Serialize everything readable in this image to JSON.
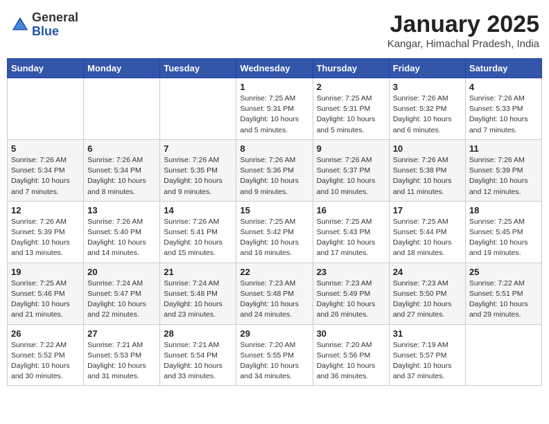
{
  "header": {
    "logo_general": "General",
    "logo_blue": "Blue",
    "title": "January 2025",
    "subtitle": "Kangar, Himachal Pradesh, India"
  },
  "weekdays": [
    "Sunday",
    "Monday",
    "Tuesday",
    "Wednesday",
    "Thursday",
    "Friday",
    "Saturday"
  ],
  "weeks": [
    [
      {
        "day": "",
        "info": ""
      },
      {
        "day": "",
        "info": ""
      },
      {
        "day": "",
        "info": ""
      },
      {
        "day": "1",
        "info": "Sunrise: 7:25 AM\nSunset: 5:31 PM\nDaylight: 10 hours\nand 5 minutes."
      },
      {
        "day": "2",
        "info": "Sunrise: 7:25 AM\nSunset: 5:31 PM\nDaylight: 10 hours\nand 5 minutes."
      },
      {
        "day": "3",
        "info": "Sunrise: 7:26 AM\nSunset: 5:32 PM\nDaylight: 10 hours\nand 6 minutes."
      },
      {
        "day": "4",
        "info": "Sunrise: 7:26 AM\nSunset: 5:33 PM\nDaylight: 10 hours\nand 7 minutes."
      }
    ],
    [
      {
        "day": "5",
        "info": "Sunrise: 7:26 AM\nSunset: 5:34 PM\nDaylight: 10 hours\nand 7 minutes."
      },
      {
        "day": "6",
        "info": "Sunrise: 7:26 AM\nSunset: 5:34 PM\nDaylight: 10 hours\nand 8 minutes."
      },
      {
        "day": "7",
        "info": "Sunrise: 7:26 AM\nSunset: 5:35 PM\nDaylight: 10 hours\nand 9 minutes."
      },
      {
        "day": "8",
        "info": "Sunrise: 7:26 AM\nSunset: 5:36 PM\nDaylight: 10 hours\nand 9 minutes."
      },
      {
        "day": "9",
        "info": "Sunrise: 7:26 AM\nSunset: 5:37 PM\nDaylight: 10 hours\nand 10 minutes."
      },
      {
        "day": "10",
        "info": "Sunrise: 7:26 AM\nSunset: 5:38 PM\nDaylight: 10 hours\nand 11 minutes."
      },
      {
        "day": "11",
        "info": "Sunrise: 7:26 AM\nSunset: 5:39 PM\nDaylight: 10 hours\nand 12 minutes."
      }
    ],
    [
      {
        "day": "12",
        "info": "Sunrise: 7:26 AM\nSunset: 5:39 PM\nDaylight: 10 hours\nand 13 minutes."
      },
      {
        "day": "13",
        "info": "Sunrise: 7:26 AM\nSunset: 5:40 PM\nDaylight: 10 hours\nand 14 minutes."
      },
      {
        "day": "14",
        "info": "Sunrise: 7:26 AM\nSunset: 5:41 PM\nDaylight: 10 hours\nand 15 minutes."
      },
      {
        "day": "15",
        "info": "Sunrise: 7:25 AM\nSunset: 5:42 PM\nDaylight: 10 hours\nand 16 minutes."
      },
      {
        "day": "16",
        "info": "Sunrise: 7:25 AM\nSunset: 5:43 PM\nDaylight: 10 hours\nand 17 minutes."
      },
      {
        "day": "17",
        "info": "Sunrise: 7:25 AM\nSunset: 5:44 PM\nDaylight: 10 hours\nand 18 minutes."
      },
      {
        "day": "18",
        "info": "Sunrise: 7:25 AM\nSunset: 5:45 PM\nDaylight: 10 hours\nand 19 minutes."
      }
    ],
    [
      {
        "day": "19",
        "info": "Sunrise: 7:25 AM\nSunset: 5:46 PM\nDaylight: 10 hours\nand 21 minutes."
      },
      {
        "day": "20",
        "info": "Sunrise: 7:24 AM\nSunset: 5:47 PM\nDaylight: 10 hours\nand 22 minutes."
      },
      {
        "day": "21",
        "info": "Sunrise: 7:24 AM\nSunset: 5:48 PM\nDaylight: 10 hours\nand 23 minutes."
      },
      {
        "day": "22",
        "info": "Sunrise: 7:23 AM\nSunset: 5:48 PM\nDaylight: 10 hours\nand 24 minutes."
      },
      {
        "day": "23",
        "info": "Sunrise: 7:23 AM\nSunset: 5:49 PM\nDaylight: 10 hours\nand 26 minutes."
      },
      {
        "day": "24",
        "info": "Sunrise: 7:23 AM\nSunset: 5:50 PM\nDaylight: 10 hours\nand 27 minutes."
      },
      {
        "day": "25",
        "info": "Sunrise: 7:22 AM\nSunset: 5:51 PM\nDaylight: 10 hours\nand 29 minutes."
      }
    ],
    [
      {
        "day": "26",
        "info": "Sunrise: 7:22 AM\nSunset: 5:52 PM\nDaylight: 10 hours\nand 30 minutes."
      },
      {
        "day": "27",
        "info": "Sunrise: 7:21 AM\nSunset: 5:53 PM\nDaylight: 10 hours\nand 31 minutes."
      },
      {
        "day": "28",
        "info": "Sunrise: 7:21 AM\nSunset: 5:54 PM\nDaylight: 10 hours\nand 33 minutes."
      },
      {
        "day": "29",
        "info": "Sunrise: 7:20 AM\nSunset: 5:55 PM\nDaylight: 10 hours\nand 34 minutes."
      },
      {
        "day": "30",
        "info": "Sunrise: 7:20 AM\nSunset: 5:56 PM\nDaylight: 10 hours\nand 36 minutes."
      },
      {
        "day": "31",
        "info": "Sunrise: 7:19 AM\nSunset: 5:57 PM\nDaylight: 10 hours\nand 37 minutes."
      },
      {
        "day": "",
        "info": ""
      }
    ]
  ]
}
